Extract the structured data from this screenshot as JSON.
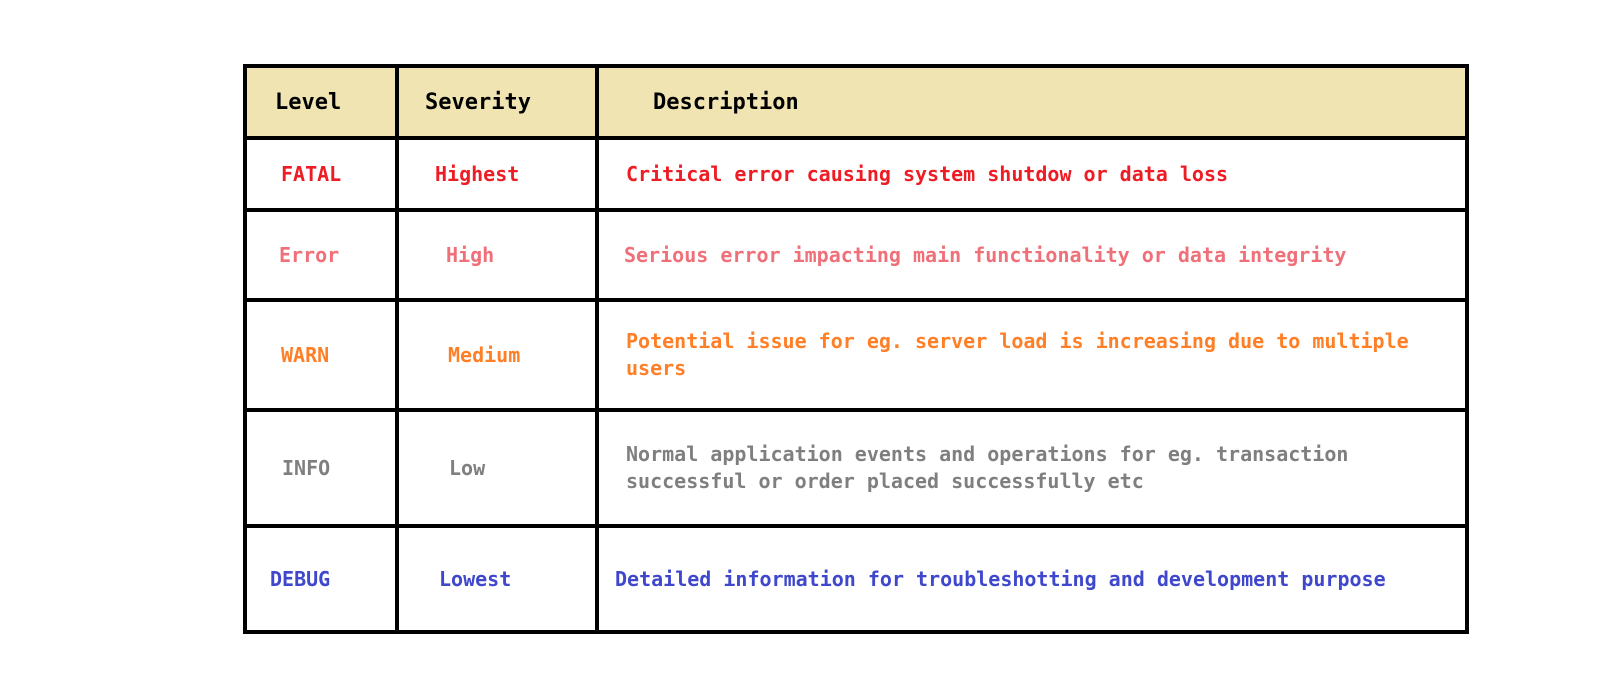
{
  "table": {
    "headers": {
      "level": "Level",
      "severity": "Severity",
      "description": "Description"
    },
    "header_background": "#f0e4b2",
    "rows": [
      {
        "level": "FATAL",
        "severity": "Highest",
        "description": "Critical error causing system shutdow or data loss",
        "color": "#ee1c24"
      },
      {
        "level": "Error",
        "severity": "High",
        "description": "Serious error impacting main functionality or data integrity",
        "color": "#f0707a"
      },
      {
        "level": "WARN",
        "severity": "Medium",
        "description": "Potential issue for eg. server load is increasing due to multiple users",
        "color": "#ff7f27"
      },
      {
        "level": "INFO",
        "severity": "Low",
        "description": "Normal application events and operations for eg. transaction successful or order placed successfully etc",
        "color": "#7f7f7f"
      },
      {
        "level": "DEBUG",
        "severity": "Lowest",
        "description": "Detailed information for troubleshotting and development purpose",
        "color": "#3f48cc"
      }
    ]
  }
}
